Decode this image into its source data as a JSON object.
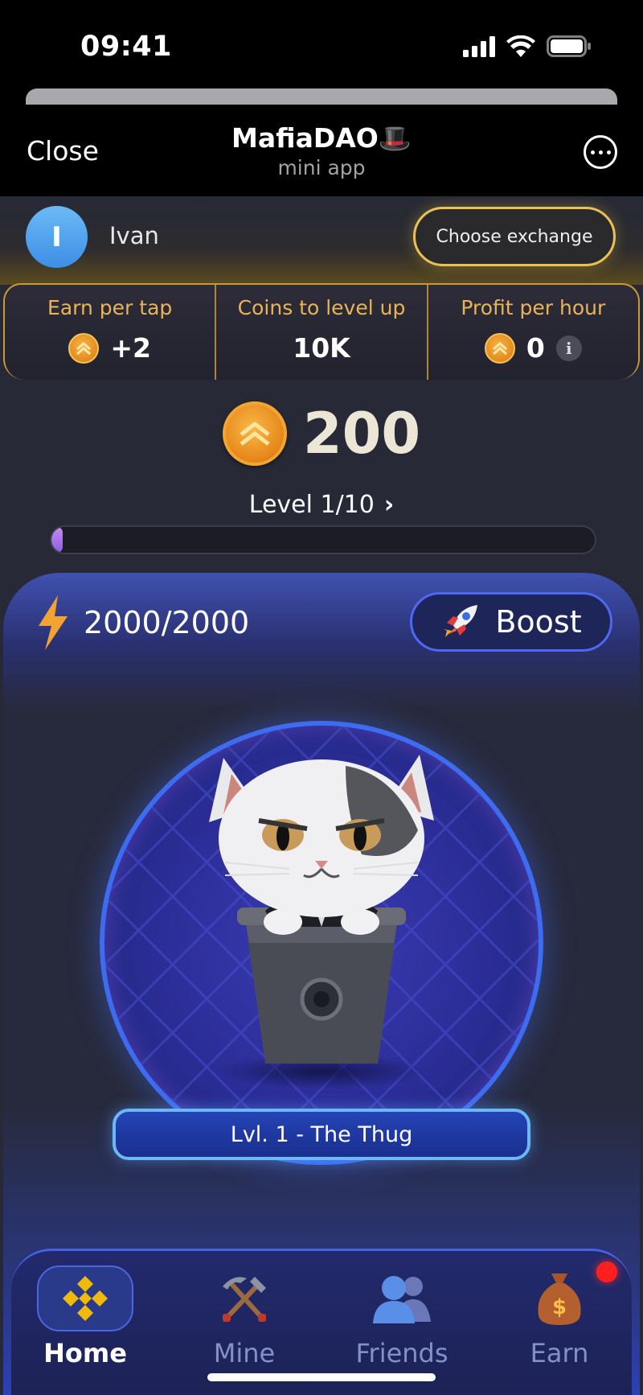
{
  "status_bar": {
    "time": "09:41"
  },
  "header": {
    "close_label": "Close",
    "title": "MafiaDAO",
    "title_emoji": "🎩",
    "subtitle": "mini app"
  },
  "user": {
    "avatar_initial": "I",
    "name": "Ivan",
    "exchange_button": "Choose exchange"
  },
  "stats": [
    {
      "label": "Earn per tap",
      "value": "+2"
    },
    {
      "label": "Coins to level up",
      "value": "10K"
    },
    {
      "label": "Profit per hour",
      "value": "0"
    }
  ],
  "balance": "200",
  "level": {
    "label": "Level 1/10",
    "progress_fraction": 0.02
  },
  "energy": {
    "value": "2000/2000"
  },
  "boost_label": "Boost",
  "rank_label": "Lvl. 1 - The Thug",
  "nav": {
    "items": [
      {
        "label": "Home",
        "icon": "binance-diamond-icon",
        "active": true
      },
      {
        "label": "Mine",
        "icon": "pickaxe-shovel-icon",
        "active": false
      },
      {
        "label": "Friends",
        "icon": "friends-icon",
        "active": false
      },
      {
        "label": "Earn",
        "icon": "money-bag-icon",
        "active": false
      }
    ]
  },
  "colors": {
    "accent_gold": "#e9b457",
    "accent_blue": "#4d68f2",
    "notification": "#ff1f1f"
  }
}
